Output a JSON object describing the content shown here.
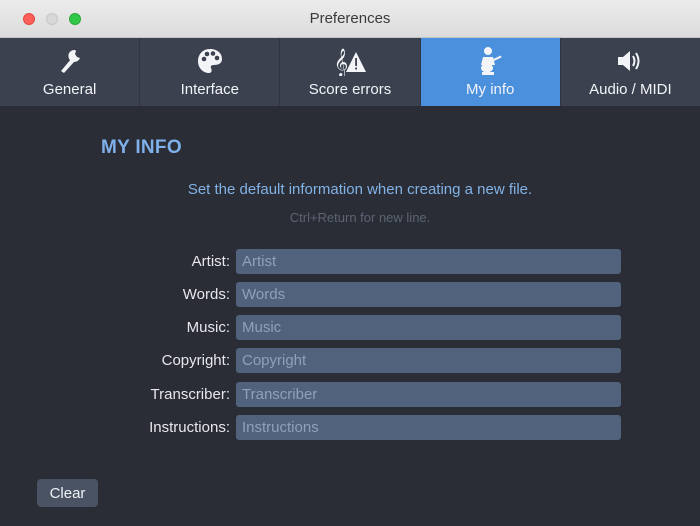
{
  "window": {
    "title": "Preferences"
  },
  "tabs": [
    {
      "label": "General",
      "icon": "wrench-icon"
    },
    {
      "label": "Interface",
      "icon": "palette-icon"
    },
    {
      "label": "Score errors",
      "icon": "clef-warning-icon"
    },
    {
      "label": "My info",
      "icon": "guitarist-icon",
      "active": true
    },
    {
      "label": "Audio / MIDI",
      "icon": "speaker-icon"
    }
  ],
  "section": {
    "heading": "MY INFO",
    "subtitle": "Set the default information when creating a new file.",
    "hint": "Ctrl+Return for new line."
  },
  "fields": [
    {
      "label": "Artist:",
      "placeholder": "Artist",
      "value": ""
    },
    {
      "label": "Words:",
      "placeholder": "Words",
      "value": ""
    },
    {
      "label": "Music:",
      "placeholder": "Music",
      "value": ""
    },
    {
      "label": "Copyright:",
      "placeholder": "Copyright",
      "value": ""
    },
    {
      "label": "Transcriber:",
      "placeholder": "Transcriber",
      "value": ""
    },
    {
      "label": "Instructions:",
      "placeholder": "Instructions",
      "value": ""
    }
  ],
  "actions": {
    "clear_label": "Clear"
  },
  "colors": {
    "accent": "#4a90dc",
    "heading": "#7fb0ea",
    "background": "#2a2d35",
    "input": "#51627c"
  }
}
